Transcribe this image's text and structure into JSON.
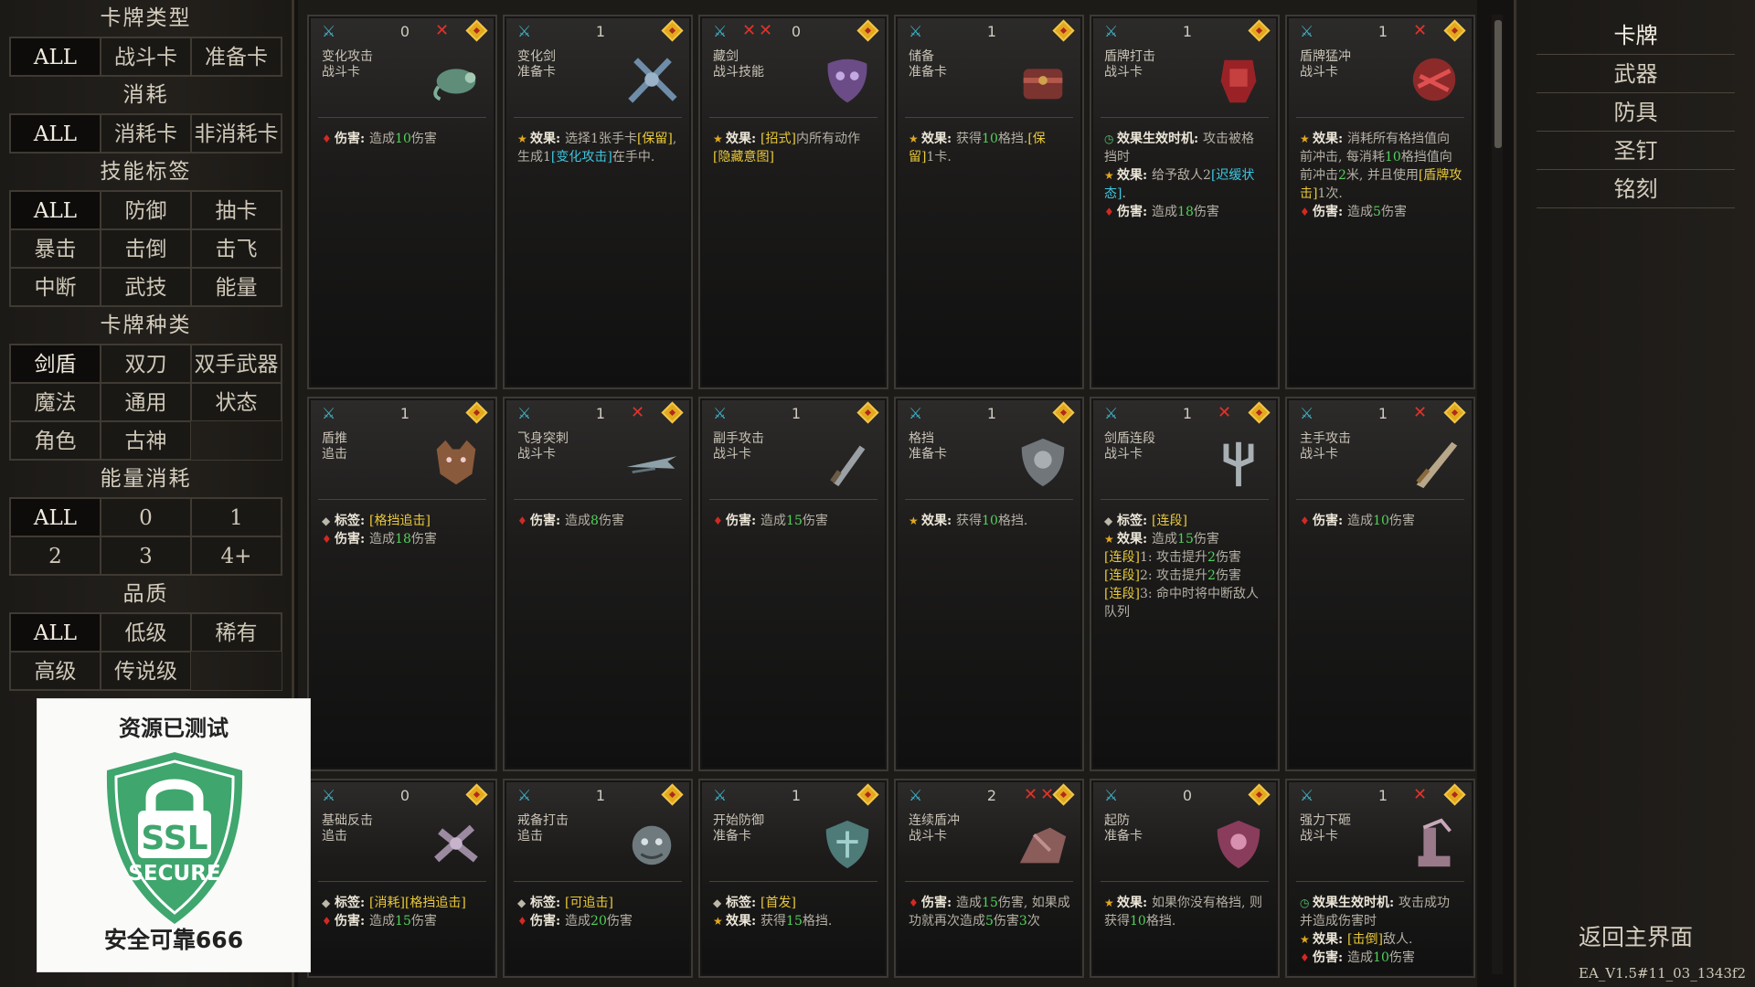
{
  "filters": {
    "card_type": {
      "title": "卡牌类型",
      "options": [
        "ALL",
        "战斗卡",
        "准备卡"
      ],
      "selected": "ALL"
    },
    "consume": {
      "title": "消耗",
      "options": [
        "ALL",
        "消耗卡",
        "非消耗卡"
      ],
      "selected": "ALL"
    },
    "skill_tags": {
      "title": "技能标签",
      "options": [
        "ALL",
        "防御",
        "抽卡",
        "暴击",
        "击倒",
        "击飞",
        "中断",
        "武技",
        "能量"
      ],
      "selected": "ALL"
    },
    "card_kind": {
      "title": "卡牌种类",
      "options": [
        "剑盾",
        "双刀",
        "双手武器",
        "魔法",
        "通用",
        "状态",
        "角色",
        "古神"
      ],
      "selected": "剑盾"
    },
    "energy": {
      "title": "能量消耗",
      "options": [
        "ALL",
        "0",
        "1",
        "2",
        "3",
        "4+"
      ],
      "selected": "ALL"
    },
    "quality": {
      "title": "品质",
      "options": [
        "ALL",
        "低级",
        "稀有",
        "高级",
        "传说级"
      ],
      "selected": "ALL"
    }
  },
  "ssl_badge": {
    "title": "资源已测试",
    "caption": "安全可靠666",
    "ssl": "SSL",
    "secure": "SECURE"
  },
  "right_menu": {
    "items": [
      "卡牌",
      "武器",
      "防具",
      "圣钉",
      "铭刻"
    ],
    "selected": "卡牌",
    "return_label": "返回主界面"
  },
  "version": "EA_V1.5#11_03_1343f2",
  "cards": [
    {
      "name": "变化攻击",
      "sub": "战斗卡",
      "cost": "0",
      "x": 1,
      "art": "chameleon",
      "lines": [
        [
          {
            "i": "dmg"
          },
          {
            "k": "伤害: "
          },
          {
            "t": "造成"
          },
          {
            "g": "10"
          },
          {
            "t": "伤害"
          }
        ]
      ]
    },
    {
      "name": "变化剑",
      "sub": "准备卡",
      "cost": "1",
      "x": 0,
      "art": "swords",
      "lines": [
        [
          {
            "i": "star"
          },
          {
            "k": "效果: "
          },
          {
            "t": "选择1张手卡"
          },
          {
            "y": "[保留]"
          },
          {
            "t": ", 生成1"
          },
          {
            "c": "[变化攻击]"
          },
          {
            "t": "在手中."
          }
        ]
      ]
    },
    {
      "name": "藏剑",
      "sub": "战斗技能",
      "cost": "0",
      "x": 2,
      "art": "mask",
      "lines": [
        [
          {
            "i": "star"
          },
          {
            "k": "效果: "
          },
          {
            "y": "[招式]"
          },
          {
            "t": "内所有动作"
          },
          {
            "y": "[隐藏意图]"
          }
        ]
      ]
    },
    {
      "name": "储备",
      "sub": "准备卡",
      "cost": "1",
      "x": 0,
      "art": "chest",
      "lines": [
        [
          {
            "i": "star"
          },
          {
            "k": "效果: "
          },
          {
            "t": "获得"
          },
          {
            "g": "10"
          },
          {
            "t": "格挡."
          },
          {
            "y": "[保留]"
          },
          {
            "t": "1卡."
          }
        ]
      ]
    },
    {
      "name": "盾牌打击",
      "sub": "战斗卡",
      "cost": "1",
      "x": 0,
      "art": "fist",
      "lines": [
        [
          {
            "i": "clock"
          },
          {
            "k": "效果生效时机: "
          },
          {
            "t": "攻击被格挡时"
          }
        ],
        [
          {
            "i": "star"
          },
          {
            "k": "效果: "
          },
          {
            "t": "给予敌人2"
          },
          {
            "c": "[迟缓状态]"
          },
          {
            "t": "."
          }
        ],
        [
          {
            "i": "dmg"
          },
          {
            "k": "伤害: "
          },
          {
            "t": "造成"
          },
          {
            "g": "18"
          },
          {
            "t": "伤害"
          }
        ]
      ]
    },
    {
      "name": "盾牌猛冲",
      "sub": "战斗卡",
      "cost": "1",
      "x": 1,
      "art": "shieldred",
      "lines": [
        [
          {
            "i": "star"
          },
          {
            "k": "效果: "
          },
          {
            "t": "消耗所有格挡值向前冲击, 每消耗"
          },
          {
            "g": "10"
          },
          {
            "t": "格挡值向前冲击"
          },
          {
            "g": "2"
          },
          {
            "t": "米, 并且使用"
          },
          {
            "y": "[盾牌攻击]"
          },
          {
            "t": "1次."
          }
        ],
        [
          {
            "i": "dmg"
          },
          {
            "k": "伤害: "
          },
          {
            "t": "造成"
          },
          {
            "g": "5"
          },
          {
            "t": "伤害"
          }
        ]
      ]
    },
    {
      "name": "盾推",
      "sub": "追击",
      "cost": "1",
      "x": 0,
      "art": "wolf",
      "lines": [
        [
          {
            "i": "tag"
          },
          {
            "k": "标签: "
          },
          {
            "y": "[格挡追击]"
          }
        ],
        [
          {
            "i": "dmg"
          },
          {
            "k": "伤害: "
          },
          {
            "t": "造成"
          },
          {
            "g": "18"
          },
          {
            "t": "伤害"
          }
        ]
      ]
    },
    {
      "name": "飞身突刺",
      "sub": "战斗卡",
      "cost": "1",
      "x": 1,
      "art": "dash",
      "lines": [
        [
          {
            "i": "dmg"
          },
          {
            "k": "伤害: "
          },
          {
            "t": "造成"
          },
          {
            "g": "8"
          },
          {
            "t": "伤害"
          }
        ]
      ]
    },
    {
      "name": "副手攻击",
      "sub": "战斗卡",
      "cost": "1",
      "x": 0,
      "art": "dagger",
      "lines": [
        [
          {
            "i": "dmg"
          },
          {
            "k": "伤害: "
          },
          {
            "t": "造成"
          },
          {
            "g": "15"
          },
          {
            "t": "伤害"
          }
        ]
      ]
    },
    {
      "name": "格挡",
      "sub": "准备卡",
      "cost": "1",
      "x": 0,
      "art": "shield",
      "lines": [
        [
          {
            "i": "star"
          },
          {
            "k": "效果: "
          },
          {
            "t": "获得"
          },
          {
            "g": "10"
          },
          {
            "t": "格挡."
          }
        ]
      ]
    },
    {
      "name": "剑盾连段",
      "sub": "战斗卡",
      "cost": "1",
      "x": 1,
      "art": "trident",
      "lines": [
        [
          {
            "i": "tag"
          },
          {
            "k": "标签: "
          },
          {
            "y": "[连段]"
          }
        ],
        [
          {
            "i": "star"
          },
          {
            "k": "效果: "
          },
          {
            "t": "造成"
          },
          {
            "g": "15"
          },
          {
            "t": "伤害"
          }
        ],
        [
          {
            "y": "[连段]"
          },
          {
            "t": "1:  攻击提升"
          },
          {
            "g": "2"
          },
          {
            "t": "伤害"
          }
        ],
        [
          {
            "y": "[连段]"
          },
          {
            "t": "2:  攻击提升"
          },
          {
            "g": "2"
          },
          {
            "t": "伤害"
          }
        ],
        [
          {
            "y": "[连段]"
          },
          {
            "t": "3:  命中时将中断敌人队列"
          }
        ]
      ]
    },
    {
      "name": "主手攻击",
      "sub": "战斗卡",
      "cost": "1",
      "x": 1,
      "art": "sword",
      "lines": [
        [
          {
            "i": "dmg"
          },
          {
            "k": "伤害: "
          },
          {
            "t": "造成"
          },
          {
            "g": "10"
          },
          {
            "t": "伤害"
          }
        ]
      ]
    },
    {
      "name": "基础反击",
      "sub": "追击",
      "cost": "0",
      "x": 0,
      "art": "counter",
      "lines": [
        [
          {
            "i": "tag"
          },
          {
            "k": "标签: "
          },
          {
            "y": "[消耗][格挡追击]"
          }
        ],
        [
          {
            "i": "dmg"
          },
          {
            "k": "伤害: "
          },
          {
            "t": "造成"
          },
          {
            "g": "15"
          },
          {
            "t": "伤害"
          }
        ]
      ]
    },
    {
      "name": "戒备打击",
      "sub": "追击",
      "cost": "1",
      "x": 0,
      "art": "beast",
      "lines": [
        [
          {
            "i": "tag"
          },
          {
            "k": "标签: "
          },
          {
            "y": "[可追击]"
          }
        ],
        [
          {
            "i": "dmg"
          },
          {
            "k": "伤害: "
          },
          {
            "t": "造成"
          },
          {
            "g": "20"
          },
          {
            "t": "伤害"
          }
        ]
      ]
    },
    {
      "name": "开始防御",
      "sub": "准备卡",
      "cost": "1",
      "x": 0,
      "art": "guard",
      "lines": [
        [
          {
            "i": "tag"
          },
          {
            "k": "标签: "
          },
          {
            "y": "[首发]"
          }
        ],
        [
          {
            "i": "star"
          },
          {
            "k": "效果: "
          },
          {
            "t": "获得"
          },
          {
            "g": "15"
          },
          {
            "t": "格挡."
          }
        ]
      ]
    },
    {
      "name": "连续盾冲",
      "sub": "战斗卡",
      "cost": "2",
      "x": 2,
      "art": "rush",
      "lines": [
        [
          {
            "i": "dmg"
          },
          {
            "k": "伤害: "
          },
          {
            "t": "造成"
          },
          {
            "g": "15"
          },
          {
            "t": "伤害, 如果成功就再次造成"
          },
          {
            "g": "5"
          },
          {
            "t": "伤害"
          },
          {
            "g": "3"
          },
          {
            "t": "次"
          }
        ]
      ]
    },
    {
      "name": "起防",
      "sub": "准备卡",
      "cost": "0",
      "x": 0,
      "art": "rise",
      "lines": [
        [
          {
            "i": "star"
          },
          {
            "k": "效果: "
          },
          {
            "t": "如果你没有格挡, 则获得"
          },
          {
            "g": "10"
          },
          {
            "t": "格挡."
          }
        ]
      ]
    },
    {
      "name": "强力下砸",
      "sub": "战斗卡",
      "cost": "1",
      "x": 1,
      "art": "smash",
      "lines": [
        [
          {
            "i": "clock"
          },
          {
            "k": "效果生效时机: "
          },
          {
            "t": "攻击成功并造成伤害时"
          }
        ],
        [
          {
            "i": "star"
          },
          {
            "k": "效果: "
          },
          {
            "y": "[击倒]"
          },
          {
            "t": "敌人."
          }
        ],
        [
          {
            "i": "dmg"
          },
          {
            "k": "伤害: "
          },
          {
            "t": "造成"
          },
          {
            "g": "10"
          },
          {
            "t": "伤害"
          }
        ]
      ]
    }
  ]
}
